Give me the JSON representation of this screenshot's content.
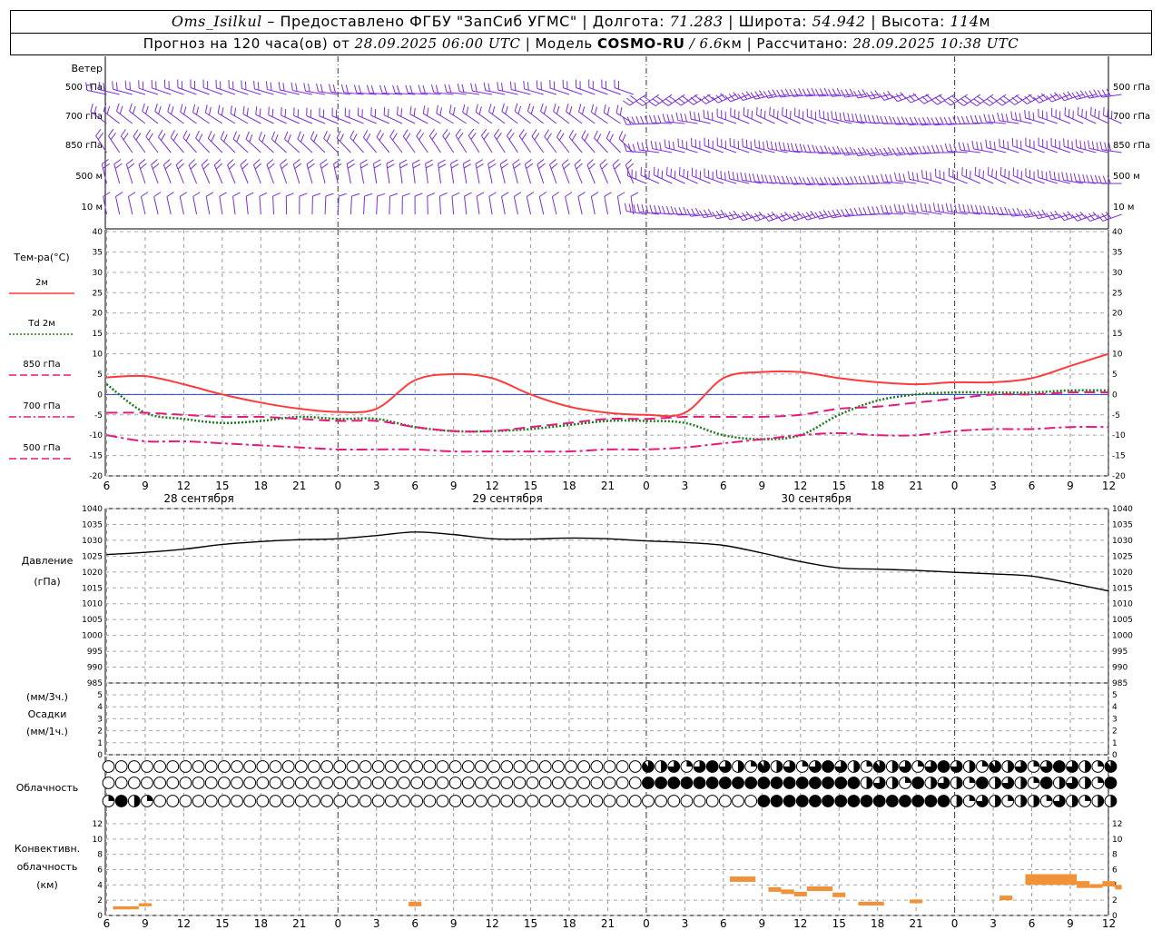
{
  "header": {
    "station": "Oms_Isilkul",
    "dash": " – ",
    "provided_prefix": "Предоставлено ФГБУ \"ЗапСиб УГМС\"",
    "lon_label": " | Долгота: ",
    "lon": "71.283",
    "lat_label": " | Широта: ",
    "lat": "54.942",
    "alt_label": " | Высота: ",
    "alt": "114",
    "alt_unit": "м",
    "forecast_prefix": "Прогноз на 120 часа(ов) от ",
    "forecast_start": "28.09.2025 06:00 UTC",
    "model_label": "  | Модель ",
    "model": "COSMO-RU",
    "model_sep": " / ",
    "resolution": "6.6",
    "resolution_unit": "км",
    "calc_label": " | Рассчитано: ",
    "calc_time": "28.09.2025 10:38 UTC"
  },
  "wind": {
    "title": "Ветер",
    "levels": [
      "500 гПа",
      "700 гПа",
      "850 гПа",
      "500 м",
      "10  м"
    ],
    "color": "#7b2fd9"
  },
  "temp": {
    "title": "Тем-ра(°C)",
    "legend": [
      {
        "label": "2м",
        "style": "solid",
        "color": "#ff3b3b"
      },
      {
        "label": "Td  2м",
        "style": "dotted",
        "color": "#1e7a1e"
      },
      {
        "label": "850 гПа",
        "style": "dash",
        "color": "#e6197f"
      },
      {
        "label": "700 гПа",
        "style": "dashdot",
        "color": "#e6197f"
      },
      {
        "label": "500 гПа",
        "style": "dash",
        "color": "#e6197f"
      }
    ],
    "yticks": [
      "40",
      "35",
      "30",
      "25",
      "20",
      "15",
      "10",
      "5",
      "0",
      "-5",
      "-10",
      "-15",
      "-20"
    ]
  },
  "pressure": {
    "title": "Давление",
    "unit": "(гПа)",
    "yticks": [
      "1040",
      "1035",
      "1030",
      "1025",
      "1020",
      "1015",
      "1010",
      "1005",
      "1000",
      "995",
      "990",
      "985"
    ]
  },
  "precip": {
    "unit1": "(мм/3ч.)",
    "title": "Осадки",
    "unit2": "(мм/1ч.)",
    "yticks": [
      "5",
      "4",
      "3",
      "2",
      "1",
      "0"
    ]
  },
  "cloud": {
    "title": "Облачность"
  },
  "conv": {
    "title1": "Конвективн.",
    "title2": "облачность",
    "unit": "(км)",
    "yticks": [
      "12",
      "10",
      "8",
      "6",
      "4",
      "2",
      "0"
    ],
    "color": "#f0923a"
  },
  "xaxis": {
    "ticks": [
      "6",
      "9",
      "12",
      "15",
      "18",
      "21",
      "0",
      "3",
      "6",
      "9",
      "12",
      "15",
      "18",
      "21",
      "0",
      "3",
      "6",
      "9",
      "12",
      "15",
      "18",
      "21",
      "0",
      "3",
      "6",
      "9",
      "12"
    ],
    "dates": [
      "28 сентября",
      "29 сентября",
      "30 сентября"
    ]
  },
  "chart_data": [
    {
      "type": "line",
      "name": "temperature",
      "x_hours_from_start": [
        0,
        3,
        6,
        9,
        12,
        15,
        18,
        21,
        24,
        27,
        30,
        33,
        36,
        39,
        42,
        45,
        48,
        51,
        54,
        57,
        60,
        63,
        66,
        69,
        72,
        75,
        78
      ],
      "ylim": [
        -20,
        40
      ],
      "series": [
        {
          "name": "2м",
          "values": [
            4.2,
            4.5,
            2.5,
            0,
            -2,
            -3.5,
            -4.3,
            -3.5,
            3.5,
            5,
            4,
            0,
            -3,
            -4.5,
            -5,
            -4.5,
            4,
            5.5,
            5.5,
            4,
            3,
            2.5,
            3,
            3,
            4,
            7,
            10
          ]
        },
        {
          "name": "Td  2м",
          "values": [
            2.5,
            -4.5,
            -6,
            -7,
            -6.5,
            -5.5,
            -6,
            -6,
            -8,
            -9,
            -9,
            -8.5,
            -7.5,
            -6.5,
            -6.5,
            -7,
            -10,
            -11,
            -10,
            -5,
            -1.5,
            0,
            0.5,
            0.5,
            0.5,
            1,
            1
          ]
        },
        {
          "name": "850 гПа",
          "values": [
            -4.5,
            -4.5,
            -5,
            -5.5,
            -5.5,
            -6,
            -6.5,
            -6.5,
            -8,
            -9,
            -9,
            -8,
            -7,
            -6,
            -6,
            -5.5,
            -5.5,
            -5.5,
            -5,
            -3.5,
            -3,
            -2,
            -1,
            0,
            0,
            0.5,
            0.5
          ]
        },
        {
          "name": "700 гПа",
          "values": [
            -10,
            -11.5,
            -11.5,
            -12,
            -12.5,
            -13,
            -13.5,
            -13.5,
            -13.5,
            -14,
            -14,
            -14,
            -14,
            -13.5,
            -13.5,
            -13,
            -12,
            -11,
            -10,
            -9.5,
            -10,
            -10,
            -9,
            -8.5,
            -8.5,
            -8,
            -8
          ]
        }
      ]
    },
    {
      "type": "line",
      "name": "pressure",
      "x_hours_from_start": [
        0,
        3,
        6,
        9,
        12,
        15,
        18,
        21,
        24,
        27,
        30,
        33,
        36,
        39,
        42,
        45,
        48,
        51,
        54,
        57,
        60,
        63,
        66,
        69,
        72,
        75,
        78
      ],
      "ylim": [
        985,
        1040
      ],
      "series": [
        {
          "name": "Давление",
          "values": [
            1025.5,
            1026.2,
            1027.2,
            1028.7,
            1029.6,
            1030.2,
            1030.5,
            1031.5,
            1032.6,
            1031.8,
            1030.5,
            1030.4,
            1030.7,
            1030.5,
            1029.8,
            1029.3,
            1028.4,
            1026,
            1023.3,
            1021.3,
            1020.9,
            1020.5,
            1019.9,
            1019.4,
            1018.7,
            1016.5,
            1014
          ]
        }
      ]
    },
    {
      "type": "bar",
      "name": "convective cloud",
      "ylim": [
        0,
        12
      ],
      "bars": [
        {
          "x_from": 0.5,
          "x_to": 2.5,
          "y_from": 0.8,
          "y_to": 1.2
        },
        {
          "x_from": 2.5,
          "x_to": 3.5,
          "y_from": 1.2,
          "y_to": 1.6
        },
        {
          "x_from": 23.5,
          "x_to": 24.5,
          "y_from": 1.2,
          "y_to": 1.8
        },
        {
          "x_from": 48.5,
          "x_to": 50.5,
          "y_from": 4.4,
          "y_to": 5.1
        },
        {
          "x_from": 51.5,
          "x_to": 52.5,
          "y_from": 3.1,
          "y_to": 3.7
        },
        {
          "x_from": 52.5,
          "x_to": 53.5,
          "y_from": 2.8,
          "y_to": 3.4
        },
        {
          "x_from": 53.5,
          "x_to": 54.5,
          "y_from": 2.5,
          "y_to": 3.1
        },
        {
          "x_from": 54.5,
          "x_to": 56.5,
          "y_from": 3.2,
          "y_to": 3.8
        },
        {
          "x_from": 56.5,
          "x_to": 57.5,
          "y_from": 2.4,
          "y_to": 3.0
        },
        {
          "x_from": 58.5,
          "x_to": 60.5,
          "y_from": 1.3,
          "y_to": 1.8
        },
        {
          "x_from": 62.5,
          "x_to": 63.5,
          "y_from": 1.6,
          "y_to": 2.1
        },
        {
          "x_from": 69.5,
          "x_to": 70.5,
          "y_from": 2.0,
          "y_to": 2.6
        },
        {
          "x_from": 71.5,
          "x_to": 75.5,
          "y_from": 4.0,
          "y_to": 5.4
        },
        {
          "x_from": 75.5,
          "x_to": 76.5,
          "y_from": 3.6,
          "y_to": 4.5
        },
        {
          "x_from": 76.5,
          "x_to": 77.5,
          "y_from": 3.6,
          "y_to": 4.1
        },
        {
          "x_from": 77.5,
          "x_to": 78.5,
          "y_from": 3.8,
          "y_to": 4.5
        },
        {
          "x_from": 78.5,
          "x_to": 79.0,
          "y_from": 3.4,
          "y_to": 4.0
        }
      ]
    },
    {
      "type": "table",
      "name": "cloud cover",
      "levels_top_to_bottom": [
        "upper",
        "middle",
        "lower"
      ],
      "symbols_per_row": 79,
      "cover_fraction": {
        "upper": {
          "0-41": 0,
          "42-78": "mixed partial 0.25-0.9"
        },
        "middle": {
          "0-41": 0,
          "42-78": "mostly overcast 1.0"
        },
        "lower": {
          "0-3": "mixed 0.5-1.0",
          "4-50": 0,
          "51-78": "mixed 0.25-1.0"
        }
      }
    }
  ]
}
